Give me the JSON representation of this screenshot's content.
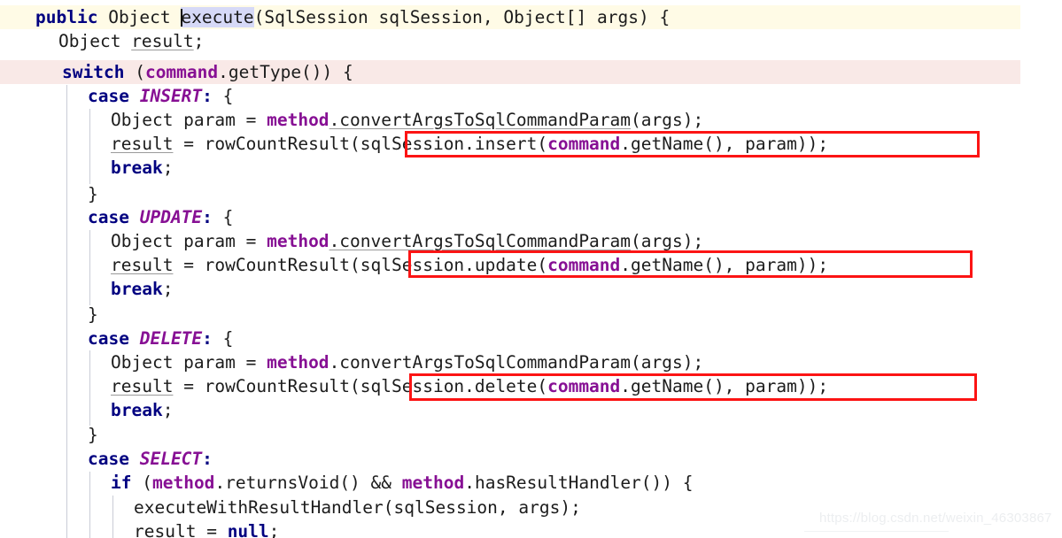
{
  "editor": {
    "language": "java",
    "colors": {
      "keyword": "#000080",
      "constant": "#871094",
      "field": "#871094",
      "text": "#1c1c1c",
      "caret_line_background": "#fffbe6",
      "switch_line_background": "#f9e9e7",
      "selection_background": "#d6d9f7",
      "indent_guide": "#c9ccd6",
      "annotation_box": "#fc1414",
      "watermark": "#eceef0"
    },
    "caret_word": "execute",
    "lines": [
      {
        "indent": 0,
        "text": "public Object execute(SqlSession sqlSession, Object[] args) {"
      },
      {
        "indent": 1,
        "text": "Object result;"
      },
      {
        "indent": 1,
        "text": "switch (command.getType()) {"
      },
      {
        "indent": 2,
        "text": "case INSERT: {"
      },
      {
        "indent": 3,
        "text": "Object param = method.convertArgsToSqlCommandParam(args);"
      },
      {
        "indent": 3,
        "text": "result = rowCountResult(sqlSession.insert(command.getName(), param));"
      },
      {
        "indent": 3,
        "text": "break;"
      },
      {
        "indent": 2,
        "text": "}"
      },
      {
        "indent": 2,
        "text": "case UPDATE: {"
      },
      {
        "indent": 3,
        "text": "Object param = method.convertArgsToSqlCommandParam(args);"
      },
      {
        "indent": 3,
        "text": "result = rowCountResult(sqlSession.update(command.getName(), param));"
      },
      {
        "indent": 3,
        "text": "break;"
      },
      {
        "indent": 2,
        "text": "}"
      },
      {
        "indent": 2,
        "text": "case DELETE: {"
      },
      {
        "indent": 3,
        "text": "Object param = method.convertArgsToSqlCommandParam(args);"
      },
      {
        "indent": 3,
        "text": "result = rowCountResult(sqlSession.delete(command.getName(), param));"
      },
      {
        "indent": 3,
        "text": "break;"
      },
      {
        "indent": 2,
        "text": "}"
      },
      {
        "indent": 2,
        "text": "case SELECT:"
      },
      {
        "indent": 3,
        "text": "if (method.returnsVoid() && method.hasResultHandler()) {"
      },
      {
        "indent": 4,
        "text": "executeWithResultHandler(sqlSession, args);"
      },
      {
        "indent": 4,
        "text": "result = null;"
      }
    ],
    "annotations": [
      {
        "label": "insert-call-highlight",
        "target": "sqlSession.insert(command.getName(), param));"
      },
      {
        "label": "update-call-highlight",
        "target": "sqlSession.update(command.getName(), param))"
      },
      {
        "label": "delete-call-highlight",
        "target": "sqlSession.delete(command.getName(), param));"
      }
    ]
  },
  "watermark": {
    "text": "https://blog.csdn.net/weixin_46303867"
  }
}
